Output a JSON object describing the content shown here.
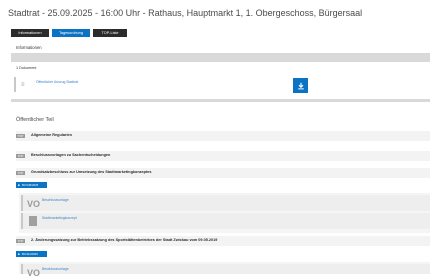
{
  "header": {
    "title": "Stadtrat - 25.09.2025 - 16:00 Uhr - Rathaus, Hauptmarkt 1, 1. Obergeschoss, Bürgersaal"
  },
  "tabs": [
    {
      "label": "Informationen",
      "active": false
    },
    {
      "label": "Tagesordnung",
      "active": true
    },
    {
      "label": "TOP-Liste",
      "active": false
    }
  ],
  "subnav": {
    "label": "Informationen"
  },
  "documents": {
    "count_label": "1 Dokument",
    "items": [
      {
        "icon": "document-icon",
        "label": "Öffentlicher Auszug Stadtrat"
      }
    ],
    "download_icon": "download-icon"
  },
  "agenda": {
    "section_title": "Öffentlicher Teil",
    "items": [
      {
        "tag": "TOP",
        "label": "Allgemeine Regularien"
      },
      {
        "tag": "TOP",
        "label": "Beschlussvorlagen zu Sachentscheidungen"
      },
      {
        "tag": "TOP",
        "label": "Grundsatzbeschluss zur Umsetzung des Stadtmarketingkonzeptes",
        "badge": "BV/136/2025",
        "subitems": [
          {
            "icon": "vo-icon",
            "label": "Beschlussvorlage"
          },
          {
            "icon": "sheet-icon",
            "label": "Stadtmarketingkonzept"
          }
        ]
      },
      {
        "tag": "TOP",
        "label": "2. Änderungssatzung zur Betriebssatzung des Sportstättenbetriebes der Stadt Zwickau vom 09.05.2019",
        "badge": "BV/111/2025",
        "subitems": [
          {
            "icon": "vo-icon",
            "label": "Beschlussvorlage"
          }
        ]
      }
    ]
  },
  "colors": {
    "accent": "#0b73c4",
    "dark_tab": "#2b2b2b",
    "link": "#3f82c7"
  }
}
